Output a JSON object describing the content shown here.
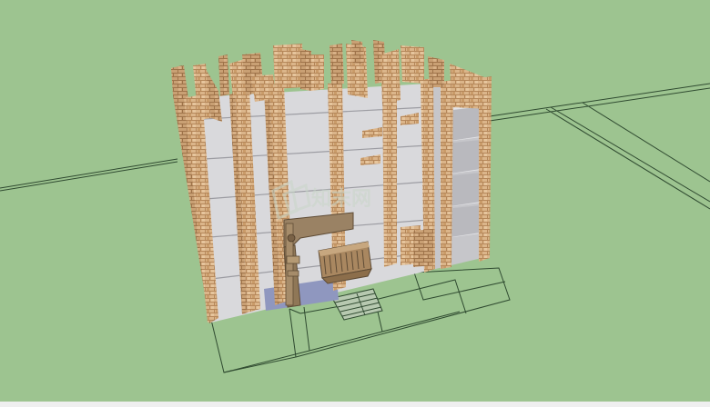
{
  "scene": {
    "colors": {
      "ground": "#9dc490",
      "ground_line": "#2f4a30",
      "floor_slab": "#d9d9dc",
      "brick": "#d9b487",
      "brick_dark": "#b98c5c",
      "glass": "#8f97bf",
      "entrance_frame": "#9a8264",
      "balustrade": "#a98760",
      "watermark_text": "#c9d6c9",
      "bottom_strip": "#efefef"
    },
    "watermark": "知末网",
    "icons": [
      "logo-watermark-icon"
    ]
  }
}
